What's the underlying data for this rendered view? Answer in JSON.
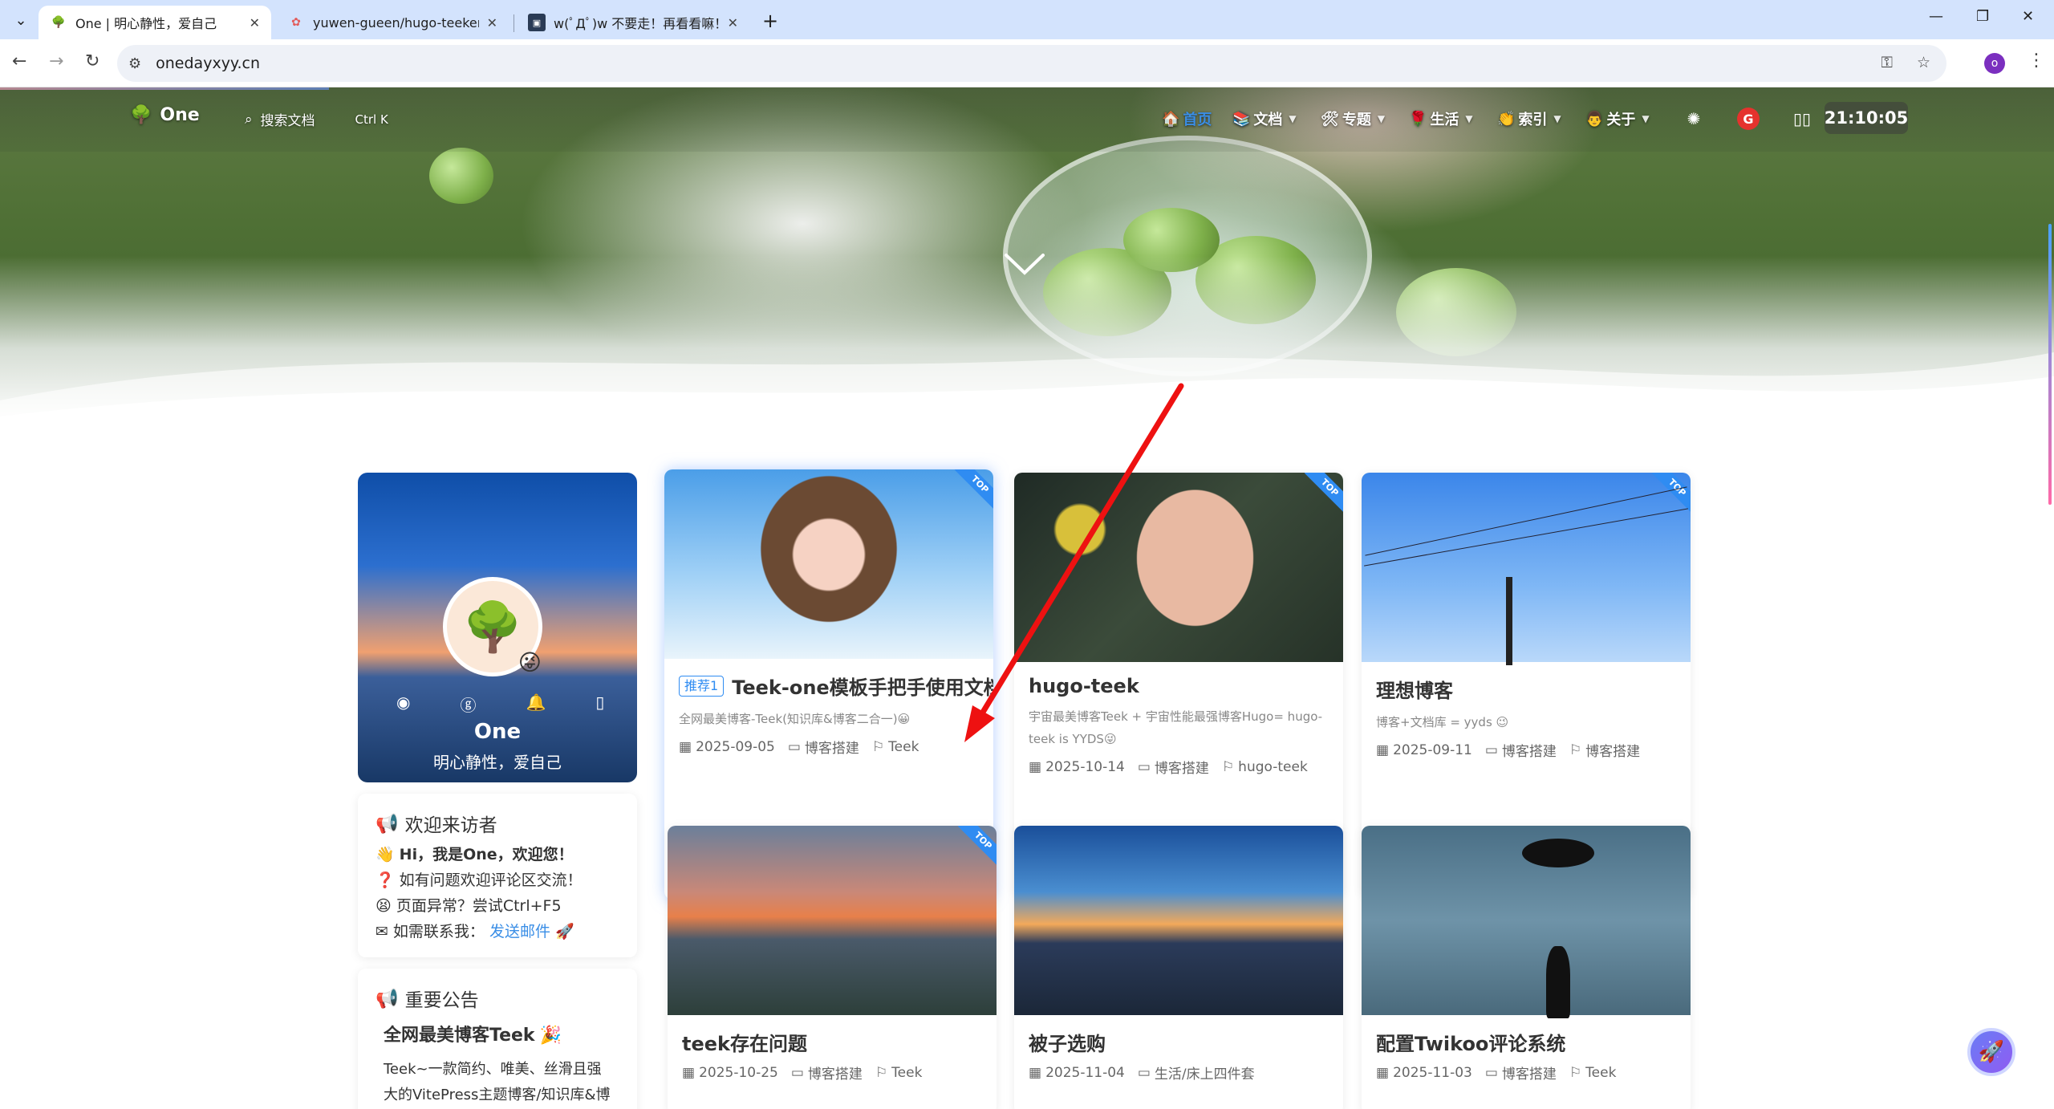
{
  "browser": {
    "tabs": [
      {
        "title": "One | 明心静性，爱自己",
        "active": true
      },
      {
        "title": "yuwen-gueen/hugo-teeker-t",
        "active": false
      },
      {
        "title": "w(ﾟДﾟ)w 不要走！再看看嘛！",
        "active": false
      }
    ],
    "url": "onedayxyy.cn",
    "profile_initial": "o"
  },
  "nav": {
    "logo_text": "One",
    "search_label": "搜索文档",
    "search_shortcut": "Ctrl K",
    "items": [
      {
        "label": "首页",
        "icon": "🏠"
      },
      {
        "label": "文档",
        "icon": "📚"
      },
      {
        "label": "专题",
        "icon": "🛠"
      },
      {
        "label": "生活",
        "icon": "🌹"
      },
      {
        "label": "索引",
        "icon": "👏"
      },
      {
        "label": "关于",
        "icon": "👨"
      }
    ],
    "clock": "21:10:05"
  },
  "profile": {
    "name": "One",
    "motto": "明心静性，爱自己"
  },
  "welcome": {
    "title": "欢迎来访者",
    "lines": [
      "Hi，我是One，欢迎您！",
      "如有问题欢迎评论区交流！",
      "页面异常？尝试Ctrl+F5"
    ],
    "contact_prefix": "如需联系我：",
    "contact_link": "发送邮件"
  },
  "notice": {
    "title": "重要公告",
    "headline": "全网最美博客Teek",
    "body_line1": "Teek~一款简约、唯美、丝滑且强",
    "body_line2": "大的VitePress主题博客/知识库&博"
  },
  "posts": [
    {
      "title": "Teek-one模板手把手使用文档",
      "tag": "推荐1",
      "desc": "全网最美博客-Teek(知识库&博客二合一)😀",
      "date": "2025-09-05",
      "category": "博客搭建",
      "label": "Teek",
      "badge": "TOP"
    },
    {
      "title": "hugo-teek",
      "desc": "宇宙最美博客Teek + 宇宙性能最强博客Hugo= hugo-teek is YYDS😜",
      "date": "2025-10-14",
      "category": "博客搭建",
      "label": "hugo-teek",
      "badge": "TOP"
    },
    {
      "title": "理想博客",
      "desc": "博客+文档库 = yyds 😉",
      "date": "2025-09-11",
      "category": "博客搭建",
      "label": "博客搭建",
      "badge": "TOP"
    },
    {
      "title": "teek存在问题",
      "date": "2025-10-25",
      "category": "博客搭建",
      "label": "Teek",
      "badge": "TOP"
    },
    {
      "title": "被子选购",
      "date": "2025-11-04",
      "category": "生活/床上四件套"
    },
    {
      "title": "配置Twikoo评论系统",
      "date": "2025-11-03",
      "category": "博客搭建",
      "label": "Teek"
    }
  ],
  "colors": {
    "accent": "#2f8cf2",
    "arrow": "#ee1111"
  }
}
